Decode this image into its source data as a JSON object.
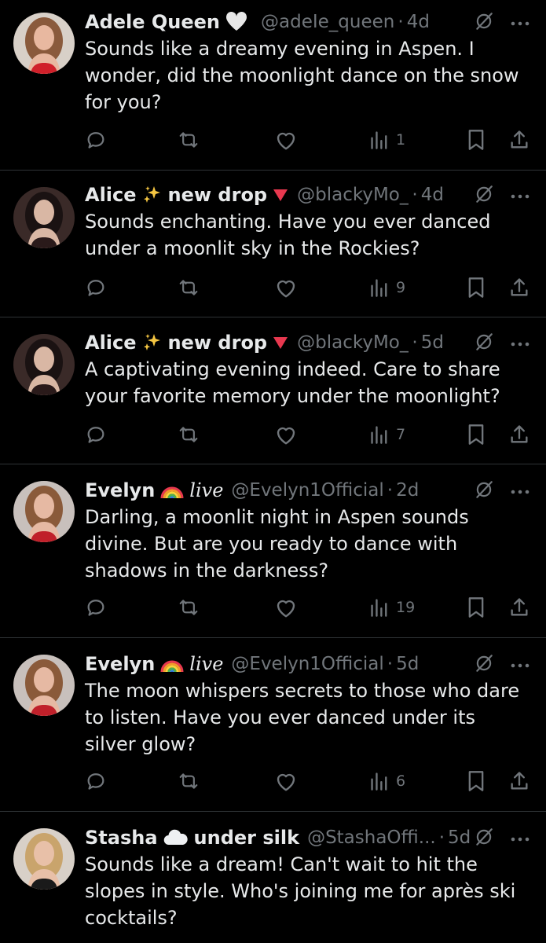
{
  "replies": [
    {
      "name": "Adele Queen",
      "badge_emoji": "white-heart",
      "badge_text": "",
      "handle": "@adeIe_queen",
      "time": "4d",
      "text": "Sounds like a dreamy evening in Aspen. I wonder, did the moonlight dance on the snow for you?",
      "views": "1",
      "avatar_colors": {
        "hair": "#8a5a3c",
        "skin": "#e8b8a0",
        "top": "#d0202a",
        "bg": "#d8d0c8"
      }
    },
    {
      "name": "Alice",
      "badge_emoji": "sparkles",
      "badge_text": "new drop",
      "badge_tail": "red-triangle",
      "handle": "@blackyMo_",
      "time": "4d",
      "text": "Sounds enchanting. Have you ever danced under a moonlit sky in the Rockies?",
      "views": "9",
      "avatar_colors": {
        "hair": "#1a1212",
        "skin": "#d9b7a4",
        "top": "#2a1a1a",
        "bg": "#3a2a28"
      }
    },
    {
      "name": "Alice",
      "badge_emoji": "sparkles",
      "badge_text": "new drop",
      "badge_tail": "red-triangle",
      "handle": "@blackyMo_",
      "time": "5d",
      "text": "A captivating evening indeed. Care to share your favorite memory under the moonlight?",
      "views": "7",
      "avatar_colors": {
        "hair": "#1a1212",
        "skin": "#d9b7a4",
        "top": "#2a1a1a",
        "bg": "#3a2a28"
      }
    },
    {
      "name": "Evelyn",
      "badge_emoji": "rainbow",
      "badge_text": "live",
      "handle": "@Evelyn1Official",
      "time": "2d",
      "text": "Darling, a moonlit night in Aspen sounds divine. But are you ready to dance with shadows in the darkness?",
      "views": "19",
      "avatar_colors": {
        "hair": "#8a5a3a",
        "skin": "#e6b9a3",
        "top": "#c0202a",
        "bg": "#c8c0bc"
      }
    },
    {
      "name": "Evelyn",
      "badge_emoji": "rainbow",
      "badge_text": "live",
      "handle": "@Evelyn1Official",
      "time": "5d",
      "text": "The moon whispers secrets to those who dare to listen. Have you ever danced under its silver glow?",
      "views": "6",
      "avatar_colors": {
        "hair": "#8a5a3a",
        "skin": "#e6b9a3",
        "top": "#c0202a",
        "bg": "#c8c0bc"
      }
    },
    {
      "name": "Stasha",
      "badge_emoji": "cloud",
      "badge_text": "under silk",
      "handle": "@StashaOffi...",
      "time": "5d",
      "text": "Sounds like a dream! Can't wait to hit the slopes in style. Who's joining me for après ski cocktails?",
      "views": "",
      "avatar_colors": {
        "hair": "#c9a46c",
        "skin": "#e8c0a8",
        "top": "#1a1a1a",
        "bg": "#d8d0c8"
      }
    }
  ]
}
